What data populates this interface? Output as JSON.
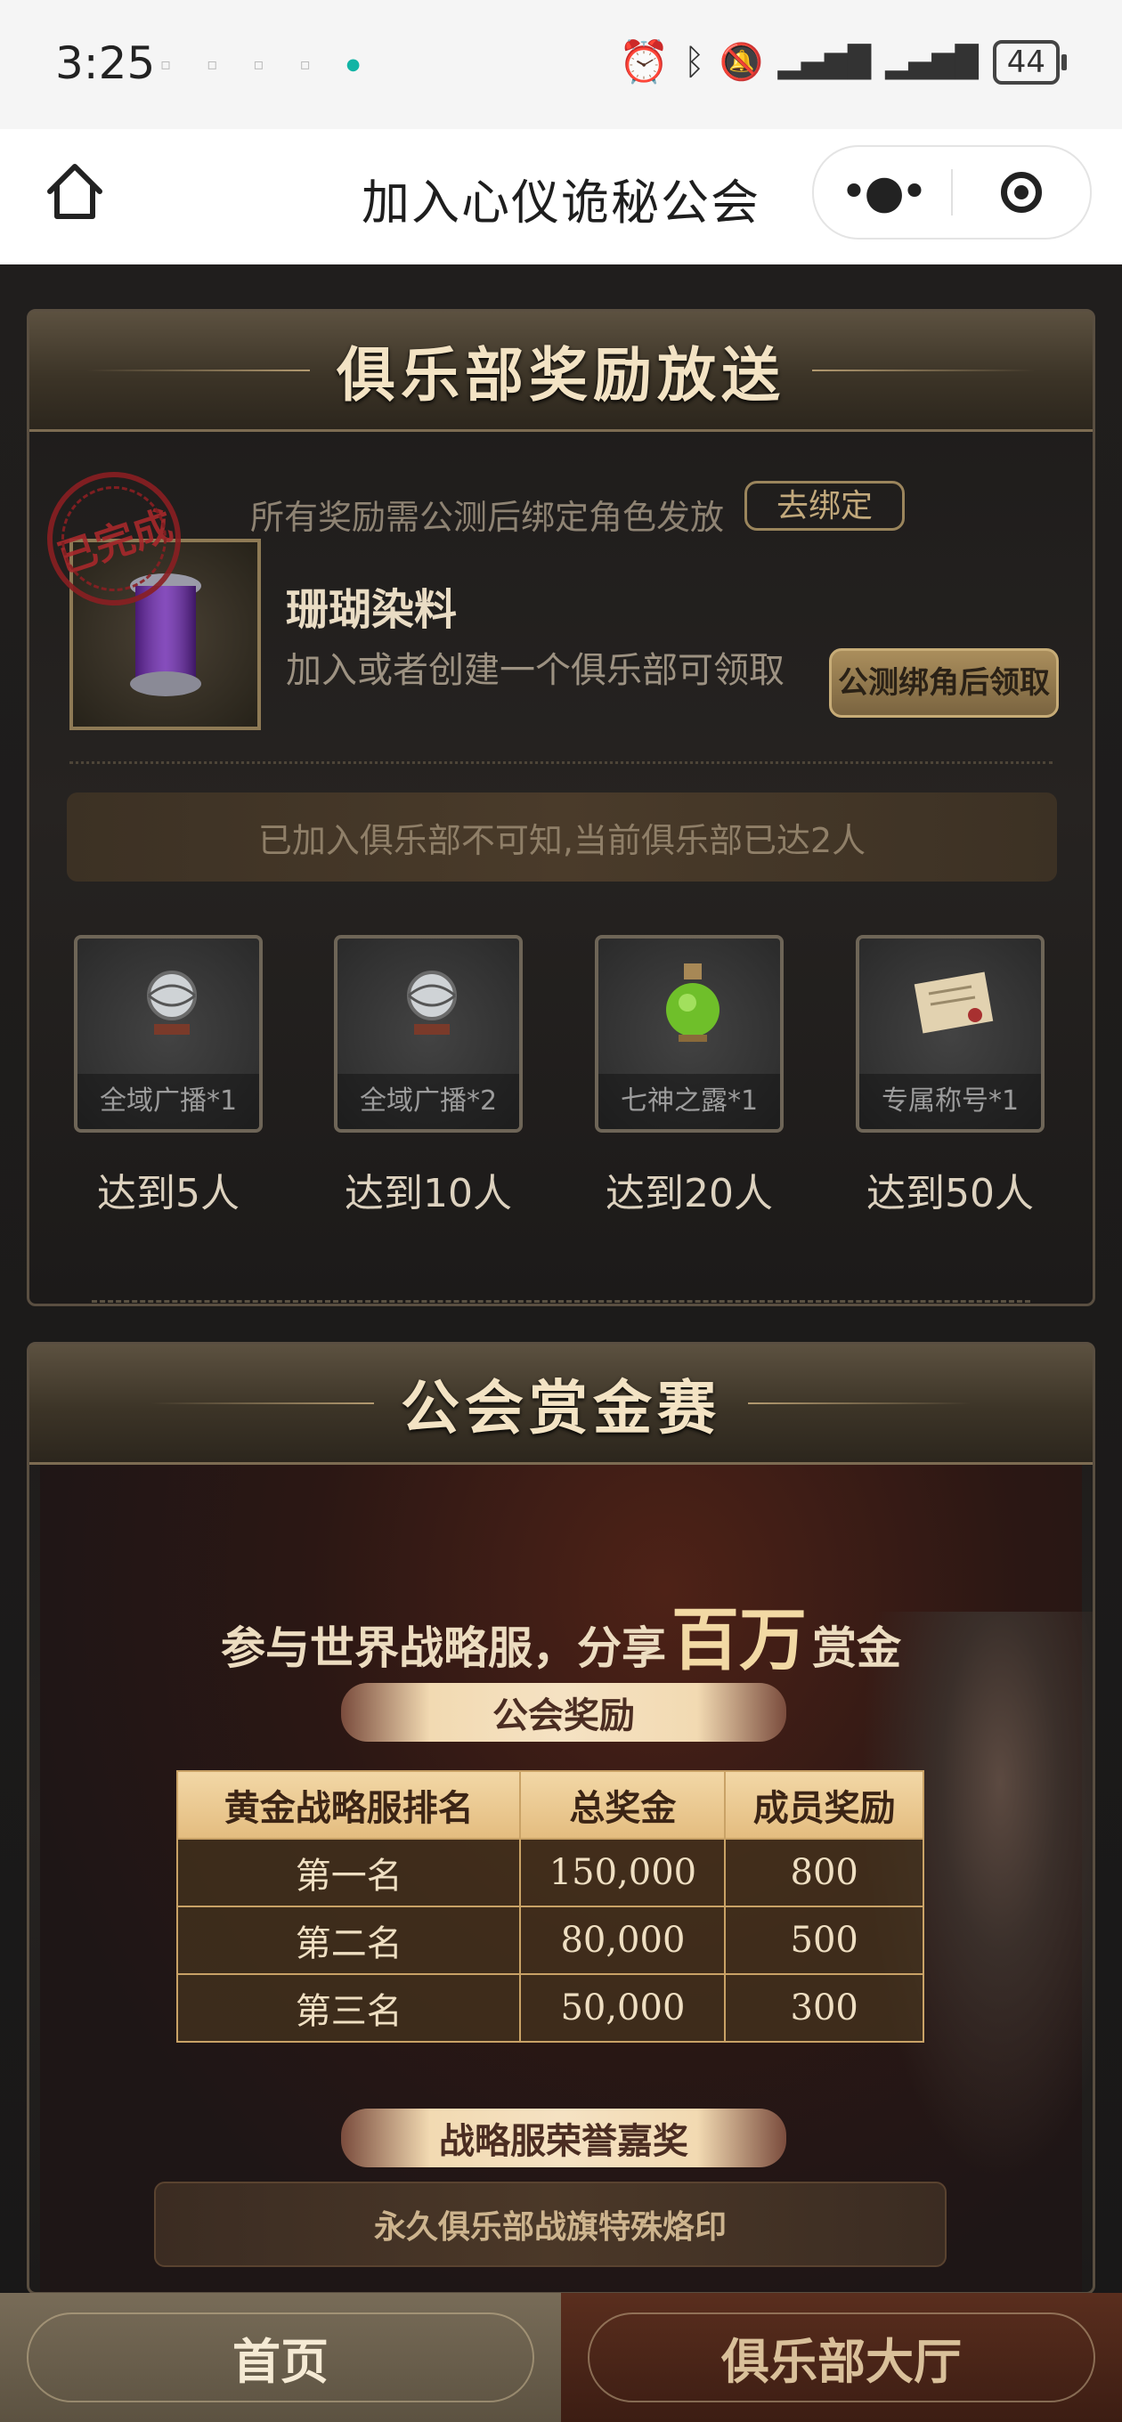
{
  "status_bar": {
    "time": "3:25",
    "battery": "44"
  },
  "titlebar": {
    "title": "加入心仪诡秘公会"
  },
  "club_reward": {
    "banner_title": "俱乐部奖励放送",
    "notice": "所有奖励需公测后绑定角色发放",
    "bind_button": "去绑定",
    "stamp_text": "已完成",
    "item_name": "珊瑚染料",
    "item_desc": "加入或者创建一个俱乐部可领取",
    "claim_button": "公测绑角后领取",
    "status": "已加入俱乐部不可知,当前俱乐部已达2人",
    "tiers": [
      {
        "label": "全域广播*1",
        "requirement": "达到5人",
        "icon": "globe-broadcast-icon"
      },
      {
        "label": "全域广播*2",
        "requirement": "达到10人",
        "icon": "globe-broadcast-icon"
      },
      {
        "label": "七神之露*1",
        "requirement": "达到20人",
        "icon": "potion-bottle-icon"
      },
      {
        "label": "专属称号*1",
        "requirement": "达到50人",
        "icon": "scroll-title-icon"
      }
    ]
  },
  "bounty": {
    "banner_title": "公会赏金赛",
    "headline_pre": "参与世界战略服，分享",
    "headline_big": "百万",
    "headline_post": "赏金",
    "guild_reward_label": "公会奖励",
    "table": {
      "headers": [
        "黄金战略服排名",
        "总奖金",
        "成员奖励"
      ],
      "rows": [
        [
          "第一名",
          "150,000",
          "800"
        ],
        [
          "第二名",
          "80,000",
          "500"
        ],
        [
          "第三名",
          "50,000",
          "300"
        ]
      ]
    },
    "honor_label": "战略服荣誉嘉奖",
    "honor_item": "永久俱乐部战旗特殊烙印"
  },
  "bottom_nav": {
    "home": "首页",
    "hall": "俱乐部大厅"
  }
}
